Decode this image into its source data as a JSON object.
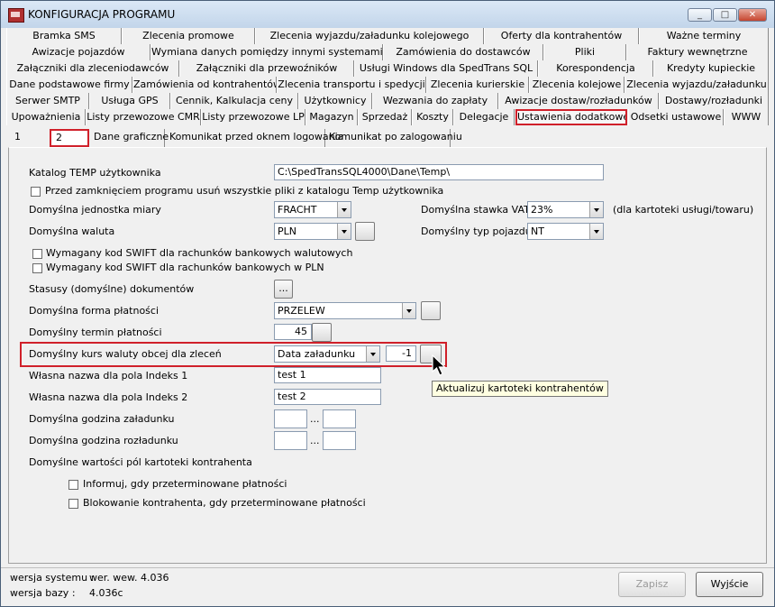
{
  "window": {
    "title": "KONFIGURACJA PROGRAMU"
  },
  "tabs": {
    "row1": [
      "Bramka SMS",
      "Zlecenia promowe",
      "Zlecenia wyjazdu/załadunku kolejowego",
      "Oferty dla kontrahentów",
      "Ważne terminy"
    ],
    "row2": [
      "Awizacje pojazdów",
      "Wymiana danych pomiędzy innymi systemami",
      "Zamówienia do dostawców",
      "Pliki",
      "Faktury wewnętrzne"
    ],
    "row3": [
      "Załączniki dla zleceniodawców",
      "Załączniki dla przewoźników",
      "Usługi Windows dla SpedTrans SQL",
      "Korespondencja",
      "Kredyty kupieckie"
    ],
    "row4": [
      "Dane podstawowe firmy",
      "Zamówienia od kontrahentów",
      "Zlecenia transportu i spedycji",
      "Zlecenia kurierskie",
      "Zlecenia kolejowe",
      "Zlecenia wyjazdu/załadunku"
    ],
    "row5": [
      "Serwer SMTP",
      "Usługa GPS",
      "Cennik, Kalkulacja ceny",
      "Użytkownicy",
      "Wezwania do zapłaty",
      "Awizacje dostaw/rozładunków",
      "Dostawy/rozładunki"
    ],
    "row6": [
      "Upoważnienia",
      "Listy przewozowe CMR",
      "Listy przewozowe LP",
      "Magazyn",
      "Sprzedaż",
      "Koszty",
      "Delegacje",
      "Ustawienia dodatkowe",
      "Odsetki ustawowe",
      "WWW"
    ]
  },
  "subtabs": [
    "1",
    "2",
    "Dane graficzne",
    "Komunikat przed oknem logowania",
    "Komunikat po zalogowaniu"
  ],
  "form": {
    "katalog_temp_label": "Katalog TEMP użytkownika",
    "katalog_temp_value": "C:\\SpedTransSQL4000\\Dane\\Temp\\",
    "usun_pliki_label": "Przed zamknięciem programu usuń wszystkie pliki z katalogu Temp użytkownika",
    "jednostka_label": "Domyślna jednostka miary",
    "jednostka_value": "FRACHT",
    "stawka_vat_label": "Domyślna stawka VAT",
    "stawka_vat_value": "23%",
    "stawka_vat_note": "(dla kartoteki usługi/towaru)",
    "waluta_label": "Domyślna waluta",
    "waluta_value": "PLN",
    "typ_pojazdu_label": "Domyślny typ pojazdu",
    "typ_pojazdu_value": "NT",
    "swift_walutowe_label": "Wymagany kod SWIFT dla rachunków bankowych walutowych",
    "swift_pln_label": "Wymagany kod SWIFT dla rachunków bankowych w PLN",
    "statusy_label": "Stasusy (domyślne) dokumentów",
    "ellipsis": "...",
    "forma_platnosci_label": "Domyślna forma płatności",
    "forma_platnosci_value": "PRZELEW",
    "termin_label": "Domyślny termin płatności",
    "termin_value": "45",
    "kurs_label": "Domyślny kurs waluty obcej dla zleceń",
    "kurs_value": "Data załadunku",
    "kurs_offset": "-1",
    "indeks1_label": "Własna nazwa dla pola Indeks 1",
    "indeks1_value": "test 1",
    "indeks2_label": "Własna nazwa dla pola Indeks 2",
    "indeks2_value": "test 2",
    "godzina_zal_label": "Domyślna godzina załadunku",
    "godzina_roz_label": "Domyślna godzina rozładunku",
    "time_sep": "...",
    "wartosci_label": "Domyślne wartości pól kartoteki kontrahenta",
    "informuj_label": "Informuj, gdy przeterminowane płatności",
    "blokowanie_label": "Blokowanie kontrahenta, gdy przeterminowane płatności"
  },
  "tooltip": "Aktualizuj kartoteki kontrahentów",
  "footer": {
    "wersja_systemu_label": "wersja systemu :",
    "wersja_systemu_value": "wer. wew. 4.036",
    "wersja_bazy_label": "wersja bazy :",
    "wersja_bazy_value": "4.036c",
    "zapisz": "Zapisz",
    "wyjscie": "Wyjście"
  },
  "colors": {
    "highlight": "#d0202a",
    "tooltip_bg": "#ffffe1"
  }
}
